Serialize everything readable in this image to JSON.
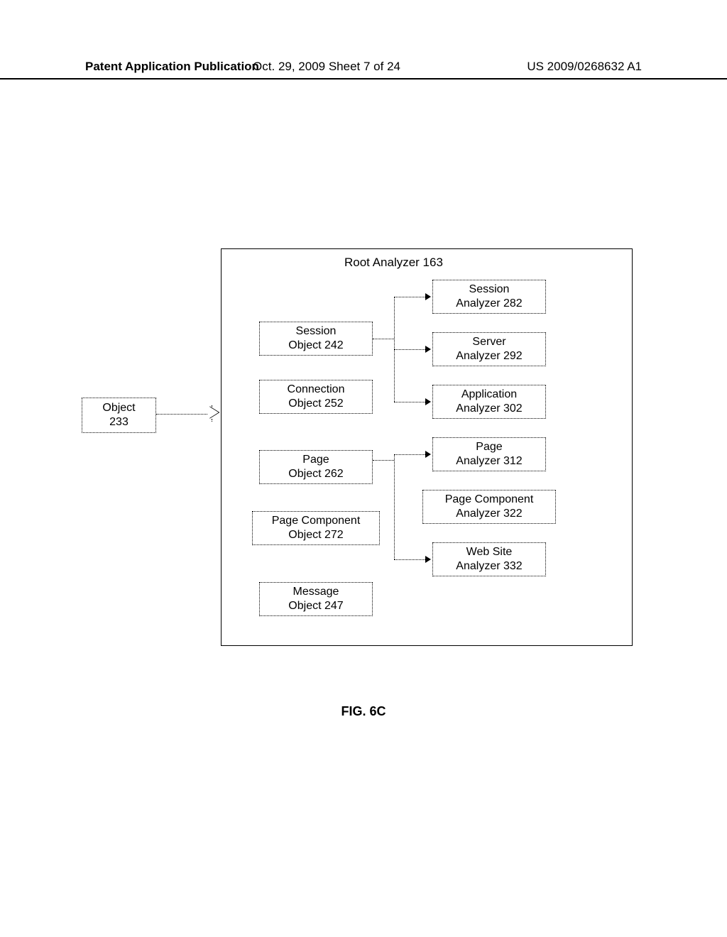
{
  "header": {
    "left": "Patent Application Publication",
    "mid": "Oct. 29, 2009  Sheet 7 of 24",
    "right": "US 2009/0268632 A1"
  },
  "figure_caption": "FIG. 6C",
  "root_label": "Root Analyzer 163",
  "left_object": "Object\n233",
  "objects_col": [
    "Session\nObject 242",
    "Connection\nObject 252",
    "Page\nObject 262",
    "Page Component\nObject 272",
    "Message\nObject 247"
  ],
  "analyzers_col": [
    "Session\nAnalyzer 282",
    "Server\nAnalyzer 292",
    "Application\nAnalyzer 302",
    "Page\nAnalyzer 312",
    "Page Component\nAnalyzer 322",
    "Web Site\nAnalyzer 332"
  ]
}
